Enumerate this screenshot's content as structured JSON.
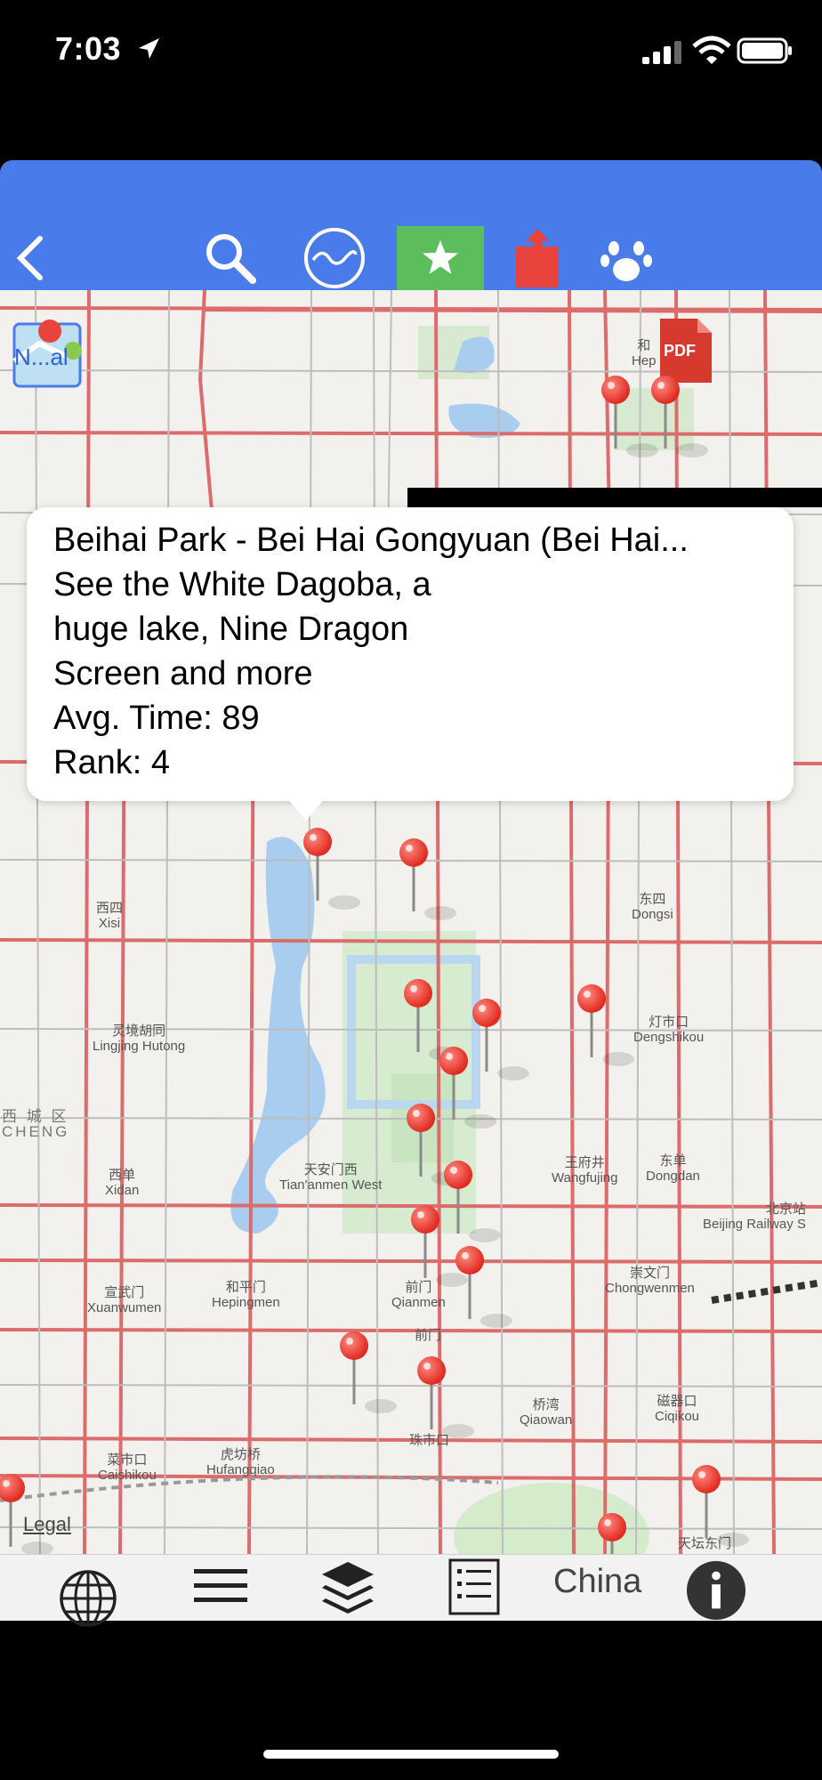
{
  "status_bar": {
    "time": "7:03"
  },
  "toolbar": {
    "back_icon": "chevron-left-icon",
    "search_icon": "search-icon",
    "wave_icon": "wave-icon",
    "favorite_icon": "star-icon",
    "share_icon": "share-icon",
    "paw_icon": "paw-icon",
    "favorite_color": "#5bbd5b",
    "bar_color": "#4a7bea"
  },
  "map": {
    "overlay_badge": "N...al",
    "pdf_badge": "PDF",
    "legal": "Legal",
    "labels": [
      {
        "text": "西四",
        "sub": "Xisi"
      },
      {
        "text": "东四",
        "sub": "Dongsi"
      },
      {
        "text": "灵境胡同",
        "sub": "Lingjing Hutong"
      },
      {
        "text": "灯市口",
        "sub": "Dengshikou"
      },
      {
        "text": "西 城 区",
        "sub": "CHENG"
      },
      {
        "text": "西单",
        "sub": "Xidan"
      },
      {
        "text": "天安门西",
        "sub": "Tian'anmen West"
      },
      {
        "text": "王府井",
        "sub": "Wangfujing"
      },
      {
        "text": "东单",
        "sub": "Dongdan"
      },
      {
        "text": "北京站",
        "sub": "Beijing Railway S"
      },
      {
        "text": "宣武门",
        "sub": "Xuanwumen"
      },
      {
        "text": "和平门",
        "sub": "Hepingmen"
      },
      {
        "text": "前门",
        "sub": "Qianmen"
      },
      {
        "text": "崇文门",
        "sub": "Chongwenmen"
      },
      {
        "text": "前门",
        "sub": ""
      },
      {
        "text": "桥湾",
        "sub": "Qiaowan"
      },
      {
        "text": "磁器口",
        "sub": "Ciqikou"
      },
      {
        "text": "菜市口",
        "sub": "Caishikou"
      },
      {
        "text": "虎坊桥",
        "sub": "Hufangqiao"
      },
      {
        "text": "珠市口",
        "sub": ""
      },
      {
        "text": "和",
        "sub": "Hep"
      },
      {
        "text": "天坛东门",
        "sub": ""
      }
    ]
  },
  "callout": {
    "title": "Beihai Park - Bei Hai Gongyuan (Bei Hai...",
    "desc_line1": "See the White Dagoba, a",
    "desc_line2": "huge lake, Nine Dragon",
    "desc_line3": "Screen and more",
    "avg_time": "Avg. Time: 89",
    "rank": "Rank: 4"
  },
  "bottom_bar": {
    "globe_icon": "globe-icon",
    "menu_icon": "menu-icon",
    "layers_icon": "layers-icon",
    "list_icon": "list-icon",
    "region": "China",
    "info_icon": "info-icon"
  }
}
